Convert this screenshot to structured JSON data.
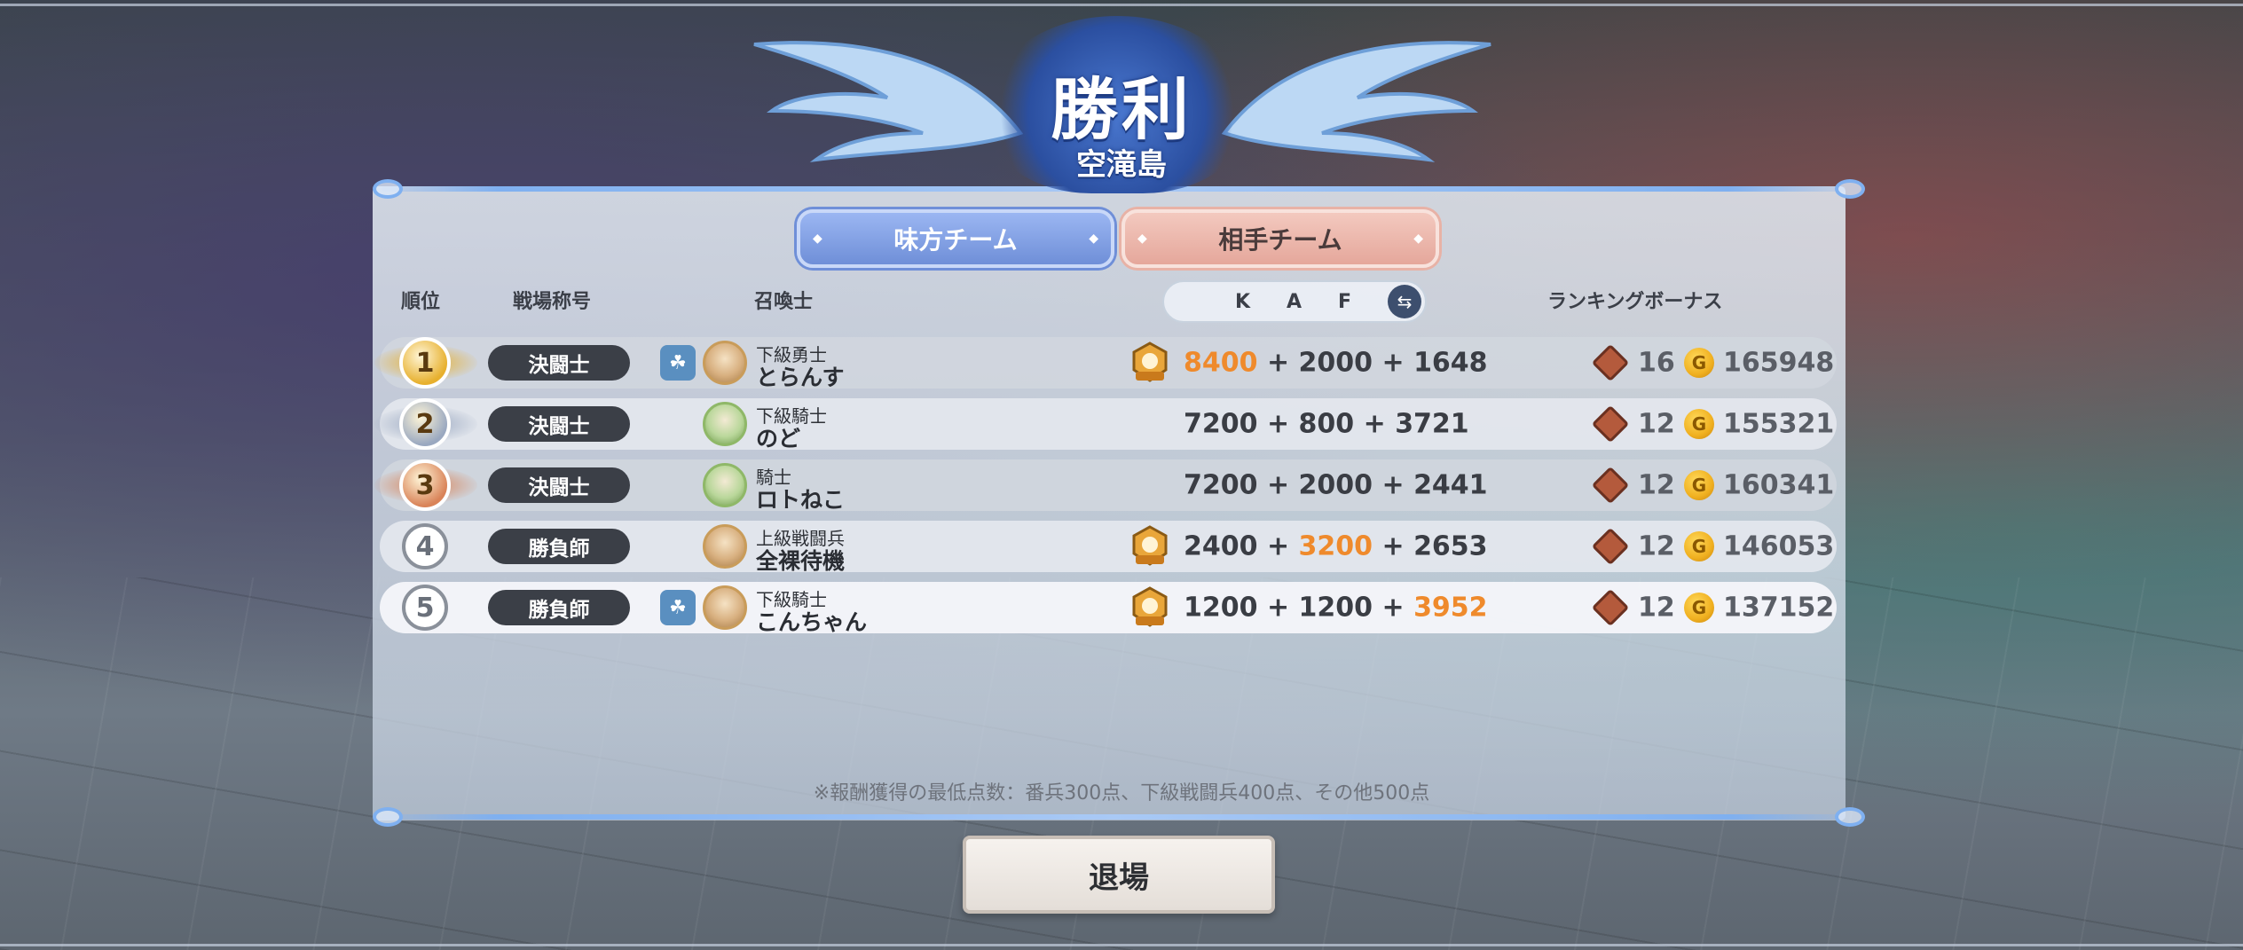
{
  "header": {
    "title": "勝利",
    "map_name": "空滝島"
  },
  "tabs": {
    "ally": "味方チーム",
    "enemy": "相手チーム"
  },
  "columns": {
    "rank": "順位",
    "battle_title": "戦場称号",
    "summoner": "召喚士",
    "k": "K",
    "a": "A",
    "f": "F",
    "ranking_bonus": "ランキングボーナス"
  },
  "rows": [
    {
      "rank": "1",
      "battle_title": "決闘士",
      "party": true,
      "summoner_rank": "下級勇士",
      "summoner_name": "とらんす",
      "mvp": true,
      "k": "8400",
      "a": "2000",
      "f": "1648",
      "highlight": "k",
      "bonus": "16",
      "coins": "165948"
    },
    {
      "rank": "2",
      "battle_title": "決闘士",
      "party": false,
      "summoner_rank": "下級騎士",
      "summoner_name": "のど",
      "mvp": false,
      "k": "7200",
      "a": "800",
      "f": "3721",
      "highlight": "",
      "bonus": "12",
      "coins": "155321"
    },
    {
      "rank": "3",
      "battle_title": "決闘士",
      "party": false,
      "summoner_rank": "騎士",
      "summoner_name": "ロトねこ",
      "mvp": false,
      "k": "7200",
      "a": "2000",
      "f": "2441",
      "highlight": "",
      "bonus": "12",
      "coins": "160341"
    },
    {
      "rank": "4",
      "battle_title": "勝負師",
      "party": false,
      "summoner_rank": "上級戦闘兵",
      "summoner_name": "全裸待機",
      "mvp": true,
      "k": "2400",
      "a": "3200",
      "f": "2653",
      "highlight": "a",
      "bonus": "12",
      "coins": "146053"
    },
    {
      "rank": "5",
      "battle_title": "勝負師",
      "party": true,
      "summoner_rank": "下級騎士",
      "summoner_name": "こんちゃん",
      "mvp": true,
      "k": "1200",
      "a": "1200",
      "f": "3952",
      "highlight": "f",
      "bonus": "12",
      "coins": "137152"
    }
  ],
  "plus": "+",
  "note": "※報酬獲得の最低点数：番兵300点、下級戦闘兵400点、その他500点",
  "exit_button": "退場",
  "colors": {
    "highlight": "#ef8a2c",
    "gold": "#e7b02e",
    "silver": "#9aa8c0",
    "bronze": "#d98358",
    "ally_tab": "#7f9ce0",
    "enemy_tab": "#e9b1a5"
  },
  "icons": {
    "party": "party-icon",
    "mvp": "mvp-icon",
    "bonus": "treasure-box-icon",
    "coin": "coin-icon",
    "swap": "swap-icon"
  }
}
